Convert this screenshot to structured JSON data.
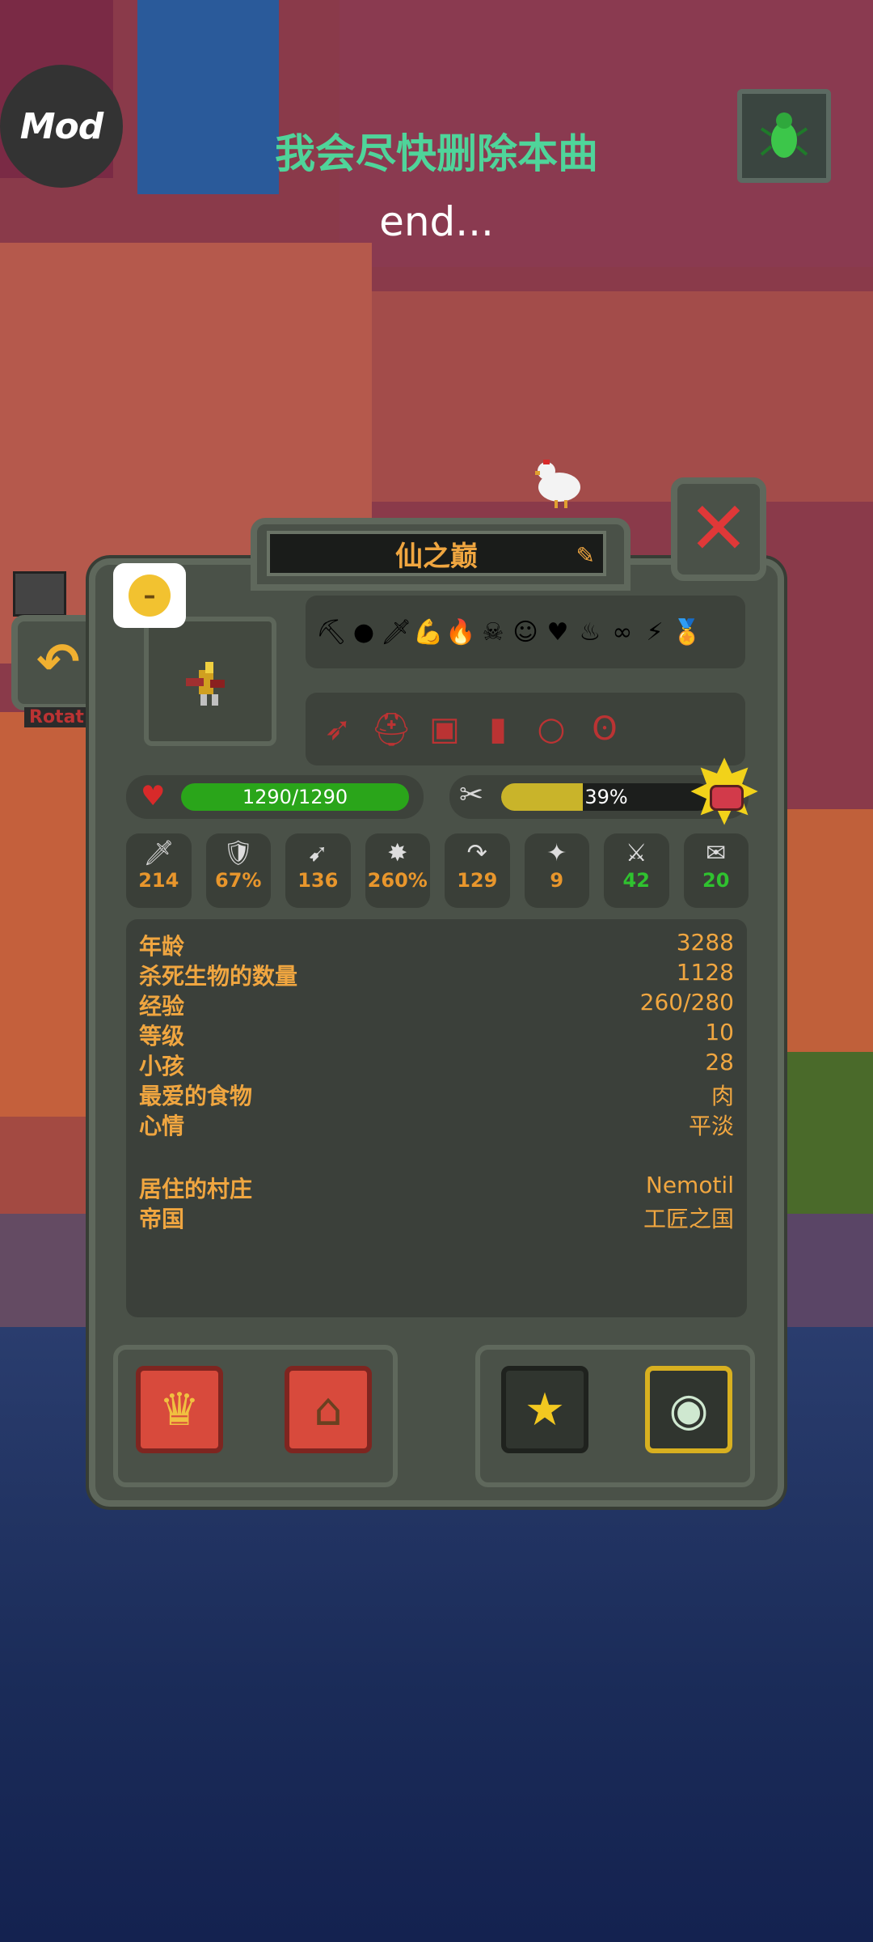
{
  "overlay": {
    "mod_label": "Mod",
    "song_title": "我会尽快删除本曲",
    "song_subtitle": "end..."
  },
  "window": {
    "title": "仙之巅",
    "edit_icon": "edit-icon",
    "close_icon": "close-icon",
    "back_icon": "back-arrow-icon",
    "side_label": "Rotat"
  },
  "mood": {
    "icon": "neutral-face-icon"
  },
  "traits": [
    {
      "icon": "pickaxe-icon",
      "glyph": "⛏"
    },
    {
      "icon": "ghost-icon",
      "glyph": "●"
    },
    {
      "icon": "dagger-icon",
      "glyph": "🗡"
    },
    {
      "icon": "strong-arm-icon",
      "glyph": "💪"
    },
    {
      "icon": "fire-face-icon",
      "glyph": "🔥"
    },
    {
      "icon": "skull-face-icon",
      "glyph": "☠"
    },
    {
      "icon": "blonde-face-icon",
      "glyph": "☺"
    },
    {
      "icon": "heart-star-icon",
      "glyph": "♥"
    },
    {
      "icon": "flame-witch-icon",
      "glyph": "♨"
    },
    {
      "icon": "infinity-icon",
      "glyph": "∞"
    },
    {
      "icon": "lightning-icon",
      "glyph": "⚡"
    },
    {
      "icon": "medal-icon",
      "glyph": "🏅"
    }
  ],
  "equipment": [
    {
      "icon": "bow-icon",
      "glyph": "➶"
    },
    {
      "icon": "helmet-icon",
      "glyph": "⛑"
    },
    {
      "icon": "armor-icon",
      "glyph": "▣"
    },
    {
      "icon": "boots-icon",
      "glyph": "▮"
    },
    {
      "icon": "ring-icon",
      "glyph": "○"
    },
    {
      "icon": "amulet-icon",
      "glyph": "ʘ"
    }
  ],
  "health": {
    "text": "1290/1290",
    "fraction": 1.0
  },
  "hunger": {
    "text": "39%",
    "fraction": 0.39
  },
  "stats": [
    {
      "icon": "damage-sword-icon",
      "glyph": "🗡",
      "value": "214",
      "green": false
    },
    {
      "icon": "armor-shield-icon",
      "glyph": "🛡",
      "value": "67%",
      "green": false
    },
    {
      "icon": "speed-wing-icon",
      "glyph": "➹",
      "value": "136",
      "green": false
    },
    {
      "icon": "crit-star-icon",
      "glyph": "✸",
      "value": "260%",
      "green": false
    },
    {
      "icon": "attack-speed-icon",
      "glyph": "↷",
      "value": "129",
      "green": false
    },
    {
      "icon": "range-icon",
      "glyph": "✦",
      "value": "9",
      "green": false
    },
    {
      "icon": "kills-swords-icon",
      "glyph": "⚔",
      "value": "42",
      "green": true
    },
    {
      "icon": "diplomacy-scroll-icon",
      "glyph": "✉",
      "value": "20",
      "green": true
    }
  ],
  "info": {
    "rows": [
      {
        "label": "年龄",
        "value": "3288"
      },
      {
        "label": "杀死生物的数量",
        "value": "1128"
      },
      {
        "label": "经验",
        "value": "260/280"
      },
      {
        "label": "等级",
        "value": "10"
      },
      {
        "label": "小孩",
        "value": "28"
      },
      {
        "label": "最爱的食物",
        "value": "肉"
      },
      {
        "label": "心情",
        "value": "平淡"
      }
    ],
    "rows2": [
      {
        "label": "居住的村庄",
        "value": "Nemotil"
      },
      {
        "label": "帝国",
        "value": "工匠之国"
      }
    ]
  },
  "bottom_buttons": [
    {
      "name": "king-crown-button",
      "glyph": "♛"
    },
    {
      "name": "village-button",
      "glyph": "⌂"
    },
    {
      "name": "favorite-star-button",
      "glyph": "★"
    },
    {
      "name": "follow-eye-button",
      "glyph": "◉"
    }
  ],
  "colors": {
    "accent_orange": "#f0a640",
    "health_green": "#2aa51a",
    "hunger_yellow": "#c9b42a",
    "close_red": "#e03838"
  }
}
